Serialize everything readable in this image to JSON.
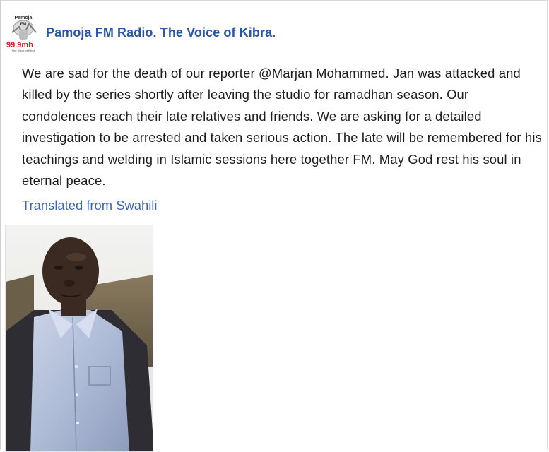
{
  "page": {
    "name": "Pamoja FM Radio. The Voice of Kibra.",
    "avatar_logo": {
      "title": "Pamoja",
      "subtitle": "FM",
      "frequency": "99.9mh",
      "tagline": "The Voice of Kibra"
    }
  },
  "post": {
    "text": "We are sad for the death of our reporter @Marjan Mohammed. Jan was attacked and killed by the series shortly after leaving the studio for ramadhan season. Our condolences reach their late relatives and friends. We are asking for a detailed investigation to be arrested and taken serious action. The late will be remembered for his teachings and welding in Islamic sessions here together FM. May God rest his soul in eternal peace.",
    "translated_label": "Translated from Swahili"
  },
  "colors": {
    "page_name": "#2a56a8",
    "link": "#3d63b5",
    "text": "#1c1c1c"
  }
}
